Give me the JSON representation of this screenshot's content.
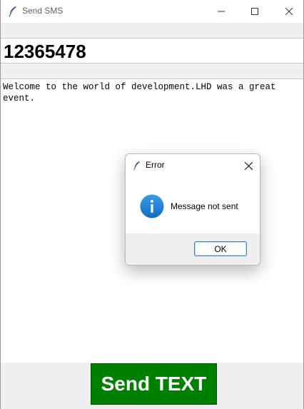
{
  "window": {
    "title": "Send SMS",
    "icons": {
      "app": "feather-icon",
      "minimize": "minimize-icon",
      "maximize": "maximize-icon",
      "close": "close-icon"
    }
  },
  "form": {
    "phone_value": "12365478",
    "message_value": "Welcome to the world of development.LHD was a great\nevent.",
    "send_label": "Send TEXT"
  },
  "dialog": {
    "title": "Error",
    "message": "Message not sent",
    "ok_label": "OK",
    "icons": {
      "app": "feather-icon",
      "info": "info-icon",
      "close": "close-icon"
    }
  },
  "colors": {
    "send_button_bg": "#008000",
    "send_button_text": "#ffffff",
    "info_icon": "#1a7fd6",
    "ok_border": "#3c7fb1"
  }
}
